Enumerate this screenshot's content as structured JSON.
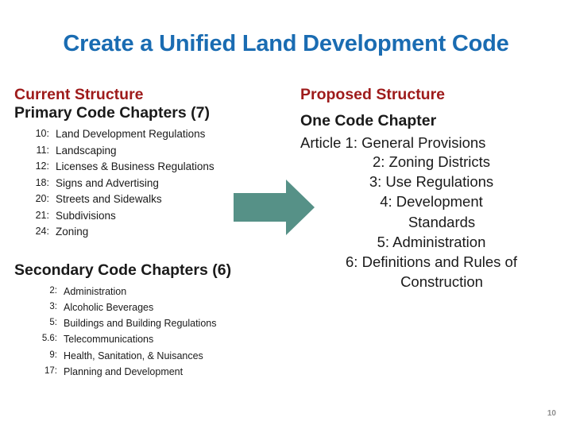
{
  "slide": {
    "title": "Create a Unified Land Development Code",
    "page_number": "10",
    "colors": {
      "title_blue": "#1a6cb2",
      "heading_red": "#9e1b1b",
      "body_dark": "#1a1a1a",
      "arrow_teal": "#569187",
      "page_number_gray": "#8e8e8e",
      "background": "#ffffff"
    }
  },
  "left_column": {
    "heading": "Current Structure",
    "primary": {
      "subheading": "Primary Code Chapters (7)",
      "items": [
        {
          "num": "10:",
          "label": "Land Development Regulations"
        },
        {
          "num": "11:",
          "label": "Landscaping"
        },
        {
          "num": "12:",
          "label": "Licenses & Business Regulations"
        },
        {
          "num": "18:",
          "label": "Signs and Advertising"
        },
        {
          "num": "20:",
          "label": "Streets and Sidewalks"
        },
        {
          "num": "21:",
          "label": "Subdivisions"
        },
        {
          "num": "24:",
          "label": "Zoning"
        }
      ]
    },
    "secondary": {
      "subheading": "Secondary Code Chapters (6)",
      "items": [
        {
          "num": "2:",
          "label": "Administration"
        },
        {
          "num": "3:",
          "label": "Alcoholic Beverages"
        },
        {
          "num": "5:",
          "label": "Buildings and Building Regulations"
        },
        {
          "num": "5.6:",
          "label": "Telecommunications"
        },
        {
          "num": "9:",
          "label": "Health, Sanitation, & Nuisances"
        },
        {
          "num": "17:",
          "label": "Planning and Development"
        }
      ]
    }
  },
  "right_column": {
    "heading": "Proposed Structure",
    "subheading": "One Code Chapter",
    "intro": "Article 1: General Provisions",
    "items": [
      {
        "text": "2: Zoning Districts",
        "wrap": ""
      },
      {
        "text": "3: Use Regulations",
        "wrap": ""
      },
      {
        "text": "4: Development",
        "wrap": "Standards"
      },
      {
        "text": "5: Administration",
        "wrap": ""
      },
      {
        "text": "6: Definitions and Rules of",
        "wrap": "Construction"
      }
    ]
  },
  "arrow": {
    "name": "right-arrow",
    "direction": "right",
    "color": "#569187"
  }
}
